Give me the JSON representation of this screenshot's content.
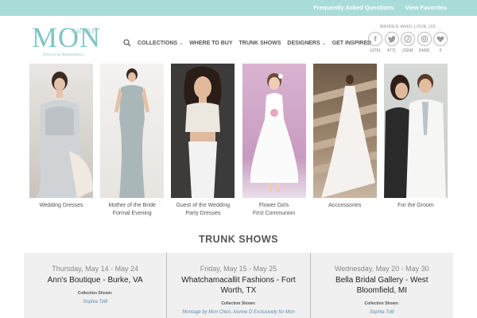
{
  "topbar": {
    "links": [
      "Frequently Asked Questions",
      "View Favorites"
    ]
  },
  "brand": {
    "logo_text": "MON",
    "logo_sub": "CHERI",
    "tagline": "Dress to be Remembered..."
  },
  "nav": {
    "items": [
      "Collections",
      "Where to Buy",
      "Trunk Shows",
      "Designers",
      "Get Inspired"
    ]
  },
  "social": {
    "heading": "Brides Who Love Us",
    "icons": [
      "facebook-icon",
      "twitter-icon",
      "pinterest-icon",
      "instagram-icon",
      "heart-icon"
    ],
    "counts": [
      "13751",
      "4771",
      "23242",
      "24432",
      "0"
    ]
  },
  "categories": [
    {
      "label": "Wedding Dresses"
    },
    {
      "label": "Mother of the Bride\nFormal Evening"
    },
    {
      "label": "Guest of the Wedding\nParty Dresses"
    },
    {
      "label": "Flower Girls\nFirst Communion"
    },
    {
      "label": "Acccessories"
    },
    {
      "label": "For the Groom"
    }
  ],
  "trunk_shows": {
    "title": "TRUNK SHOWS",
    "shows": [
      {
        "date": "Thursday, May 14 - May 24",
        "venue": "Ann's Boutique - Burke, VA",
        "collection_label": "Collection Shown:",
        "designers": "Sophia Tolli"
      },
      {
        "date": "Friday, May 15 - May 25",
        "venue": "Whatchamacallit Fashions - Fort Worth, TX",
        "collection_label": "Collection Shown:",
        "designers": "Montage by Mon Cheri, Ivonne D Exclusively for Mon"
      },
      {
        "date": "Wednesday, May 20 - May 30",
        "venue": "Bella Bridal Gallery - West Bloomfield, MI",
        "collection_label": "Collection Shown:",
        "designers": "Sophia Tolli"
      }
    ]
  },
  "colors": {
    "topbar": "#a9dcd8",
    "brand_teal": "#7fc6c2",
    "link_blue": "#5a8ab0",
    "panel_gray": "#f0f0f0"
  }
}
